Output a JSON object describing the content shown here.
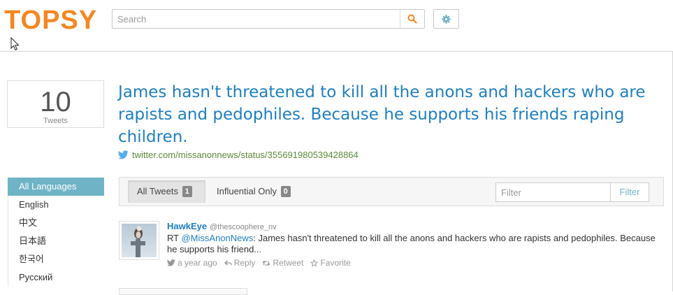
{
  "header": {
    "logo": "TOPSY",
    "search_placeholder": "Search"
  },
  "count": {
    "value": "10",
    "label": "Tweets"
  },
  "headline": "James hasn't threatened to kill all the anons and hackers who are rapists and pedophiles. Because he supports his friends raping children.",
  "source_url": "twitter.com/missanonnews/status/355691980539428864",
  "languages": [
    "All Languages",
    "English",
    "中文",
    "日本語",
    "한국어",
    "Русский"
  ],
  "tabs": {
    "all_label": "All Tweets",
    "all_count": "1",
    "influential_label": "Influential Only",
    "influential_count": "0",
    "filter_placeholder": "Filter",
    "filter_button": "Filter"
  },
  "tweet": {
    "author": "HawkEye",
    "handle": "@thescoophere_nv",
    "prefix": "RT ",
    "mention": "@MissAnonNews",
    "text": ": James hasn't threatened to kill all the anons and hackers who are rapists and pedophiles. Because he supports his friend...",
    "time": "a year ago",
    "reply": "Reply",
    "retweet": "Retweet",
    "favorite": "Favorite"
  },
  "colors": {
    "brand": "#f48722",
    "link": "#1e7fc0",
    "active_language": "#6fb3c6",
    "source_link": "#5a8a3a"
  },
  "icons": [
    "search-icon",
    "gear-icon",
    "twitter-bird-icon",
    "reply-icon",
    "retweet-icon",
    "star-icon",
    "cursor-icon"
  ]
}
